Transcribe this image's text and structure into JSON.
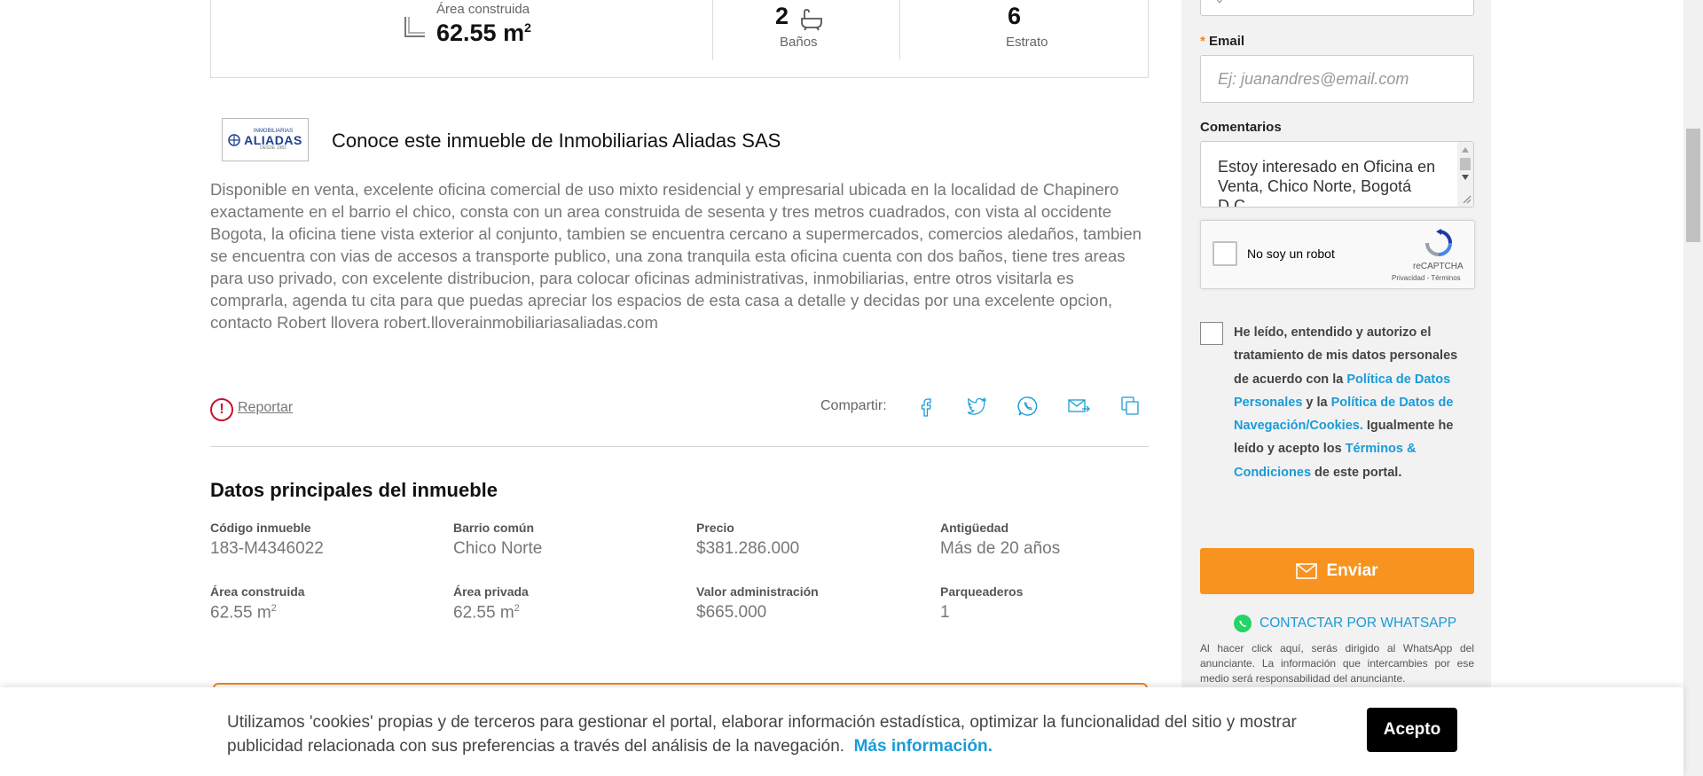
{
  "stats": {
    "area_label": "Área construida",
    "area_value": "62.55 m",
    "area_sup": "2",
    "baths_value": "2",
    "baths_label": "Baños",
    "estrato_value": "6",
    "estrato_label": "Estrato"
  },
  "agency": {
    "logo_top": "INMOBILIARIAS",
    "logo_main": "ALIADAS",
    "logo_sub": "DESDE 1982",
    "title": "Conoce este inmueble de Inmobiliarias Aliadas SAS"
  },
  "description": "Disponible en venta, excelente oficina comercial de uso mixto residencial y empresarial ubicada en la localidad de Chapinero exactamente en el barrio el chico, consta con un area construida de sesenta y tres metros cuadrados, con vista al occidente Bogota, la oficina tiene vista exterior al conjunto, tambien se encuentra cercano a supermercados, comercios aledaños, tambien se encuentra con vias de accesos a transporte publico, una zona tranquila esta oficina cuenta con dos baños, tiene tres areas para uso privado, con excelente distribucion, para colocar oficinas administrativas, inmobiliarias, entre otros visitarla es comprarla, agenda tu cita para que puedas apreciar los espacios de esta casa a detalle y decidas por una excelente opcion, contacto Robert llovera robert.lloverainmobiliariasaliadas.com",
  "actions": {
    "report_icon": "!",
    "report_label": "Reportar",
    "share_label": "Compartir:",
    "share_icons": [
      "facebook-icon",
      "twitter-icon",
      "whatsapp-icon",
      "email-icon",
      "copy-icon"
    ]
  },
  "main_data": {
    "title": "Datos principales del inmueble",
    "fields": [
      {
        "label": "Código inmueble",
        "value": "183-M4346022"
      },
      {
        "label": "Barrio común",
        "value": "Chico Norte"
      },
      {
        "label": "Precio",
        "value": "$381.286.000"
      },
      {
        "label": "Antigüedad",
        "value": "Más de 20 años"
      },
      {
        "label": "Área construida",
        "value": "62.55 m",
        "sup": "2"
      },
      {
        "label": "Área privada",
        "value": "62.55 m",
        "sup": "2"
      },
      {
        "label": "Valor administración",
        "value": "$665.000"
      },
      {
        "label": "Parqueaderos",
        "value": "1"
      }
    ]
  },
  "form": {
    "required_mark": "*",
    "email_label": "Email",
    "email_placeholder": "Ej: juanandres@email.com",
    "comments_label": "Comentarios",
    "comments_value": "Estoy interesado en Oficina en Venta, Chico Norte, Bogotá D.C.",
    "captcha_label": "No soy un robot",
    "captcha_brand": "reCAPTCHA",
    "captcha_links": "Privacidad - Términos",
    "consent": {
      "part1": "He leído, entendido y autorizo el tratamiento de mis datos personales de acuerdo con la ",
      "link1": "Política de Datos Personales",
      "part2": " y la ",
      "link2": "Política de Datos de Navegación/Cookies.",
      "part3": " Igualmente he leído y acepto los ",
      "link3": "Términos & Condiciones",
      "part4": " de este portal."
    },
    "send_label": "Enviar",
    "whatsapp_label": "CONTACTAR POR WHATSAPP",
    "disclaimer": "Al hacer click aquí, serás dirigido al WhatsApp del anunciante. La información que intercambies por ese medio será responsabilidad del anunciante."
  },
  "cookie": {
    "text": "Utilizamos 'cookies' propias y de terceros para gestionar el portal, elaborar información estadística, optimizar la funcionalidad del sitio y mostrar publicidad relacionada con sus preferencias a través del análisis de la navegación.",
    "link": "Más información.",
    "accept": "Acepto"
  },
  "colors": {
    "accent": "#f7931e",
    "link": "#1a9bd7",
    "report": "#c8102e"
  }
}
